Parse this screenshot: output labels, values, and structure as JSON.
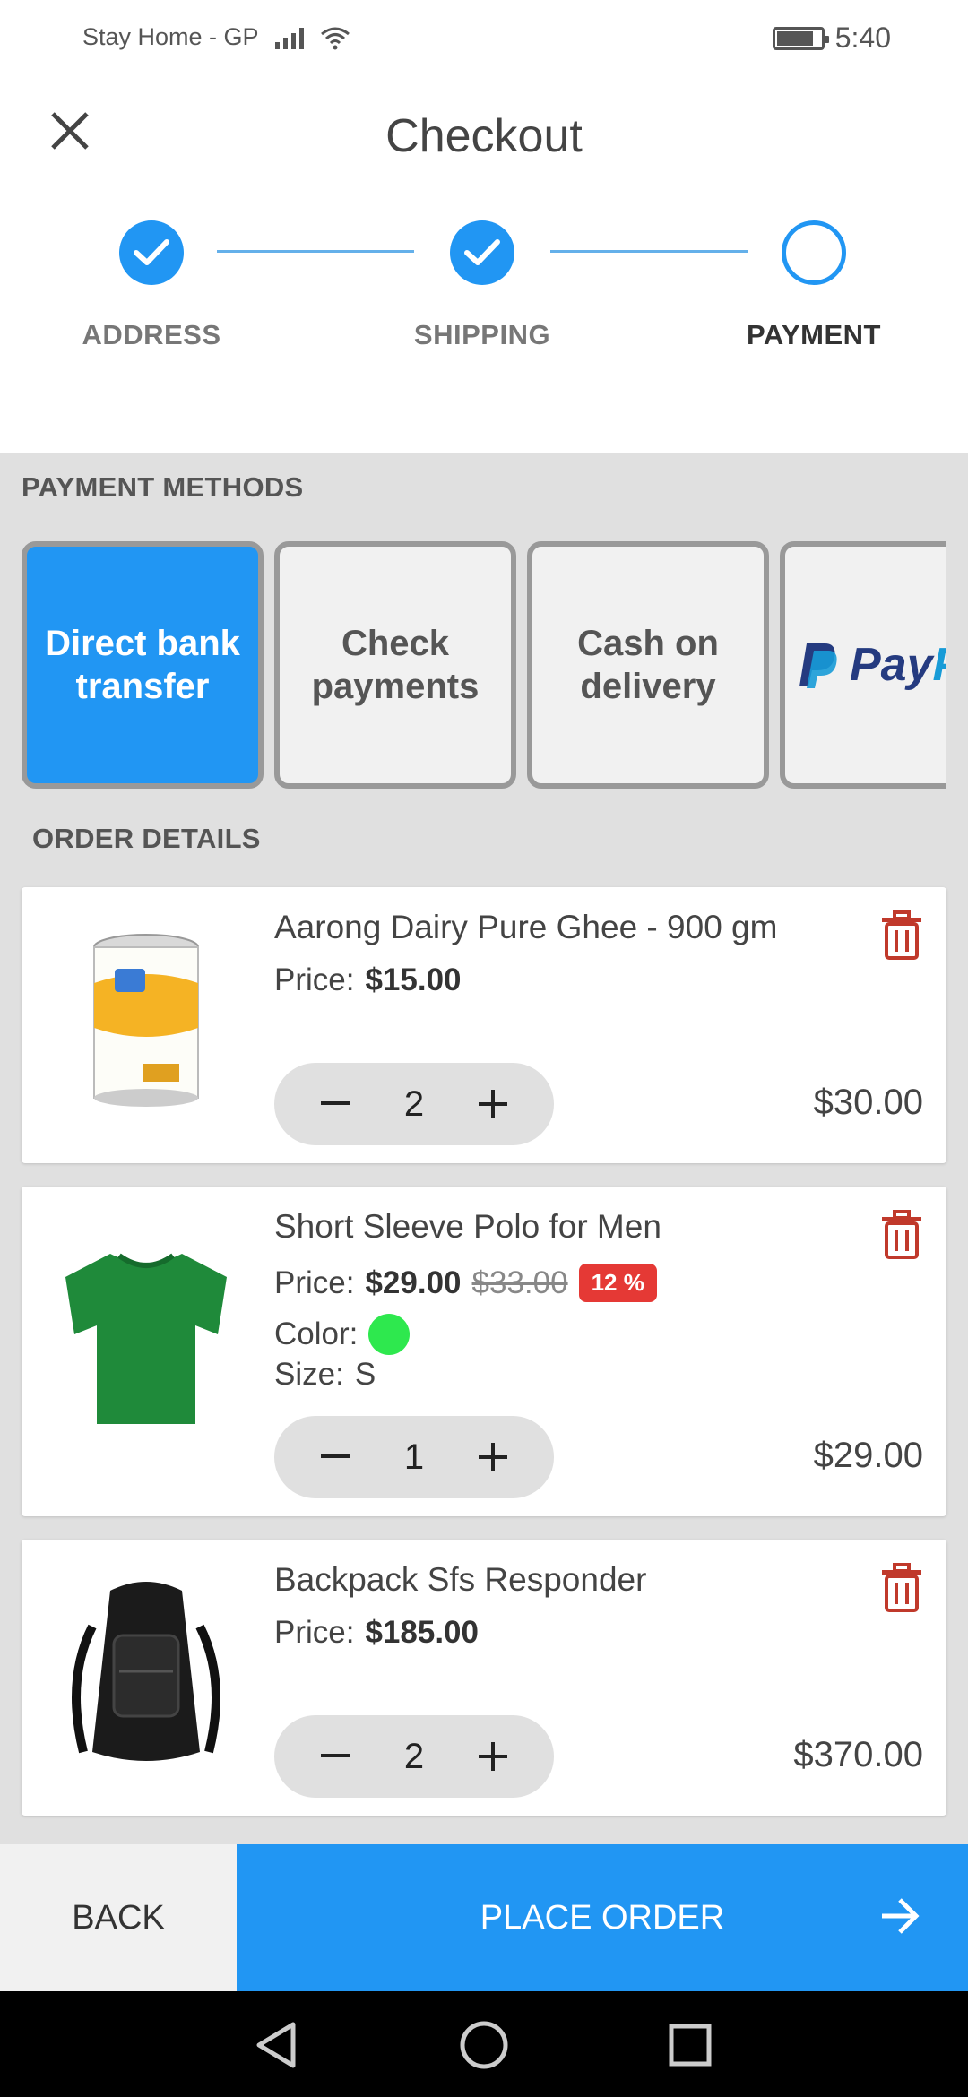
{
  "status_bar": {
    "carrier": "Stay Home - GP",
    "time": "5:40"
  },
  "header": {
    "title": "Checkout"
  },
  "steps": [
    {
      "label": "ADDRESS",
      "state": "done"
    },
    {
      "label": "SHIPPING",
      "state": "done"
    },
    {
      "label": "PAYMENT",
      "state": "current"
    }
  ],
  "payment": {
    "section_title": "PAYMENT METHODS",
    "methods": [
      {
        "label": "Direct bank transfer",
        "selected": true
      },
      {
        "label": "Check payments",
        "selected": false
      },
      {
        "label": "Cash on delivery",
        "selected": false
      },
      {
        "label": "PayPal",
        "selected": false
      }
    ]
  },
  "order": {
    "section_title": "ORDER DETAILS",
    "price_label": "Price:",
    "color_label": "Color:",
    "size_label": "Size:",
    "items": [
      {
        "name": "Aarong Dairy Pure Ghee - 900 gm",
        "price": "$15.00",
        "quantity": "2",
        "subtotal": "$30.00"
      },
      {
        "name": "Short Sleeve Polo for Men",
        "price": "$29.00",
        "old_price": "$33.00",
        "discount": "12 %",
        "color": "#2ee84e",
        "size": "S",
        "quantity": "1",
        "subtotal": "$29.00"
      },
      {
        "name": "Backpack Sfs Responder",
        "price": "$185.00",
        "quantity": "2",
        "subtotal": "$370.00"
      }
    ]
  },
  "actions": {
    "back_label": "BACK",
    "place_order_label": "PLACE ORDER"
  },
  "colors": {
    "accent": "#2196f3",
    "discount": "#e53935",
    "trash": "#c0392b"
  }
}
